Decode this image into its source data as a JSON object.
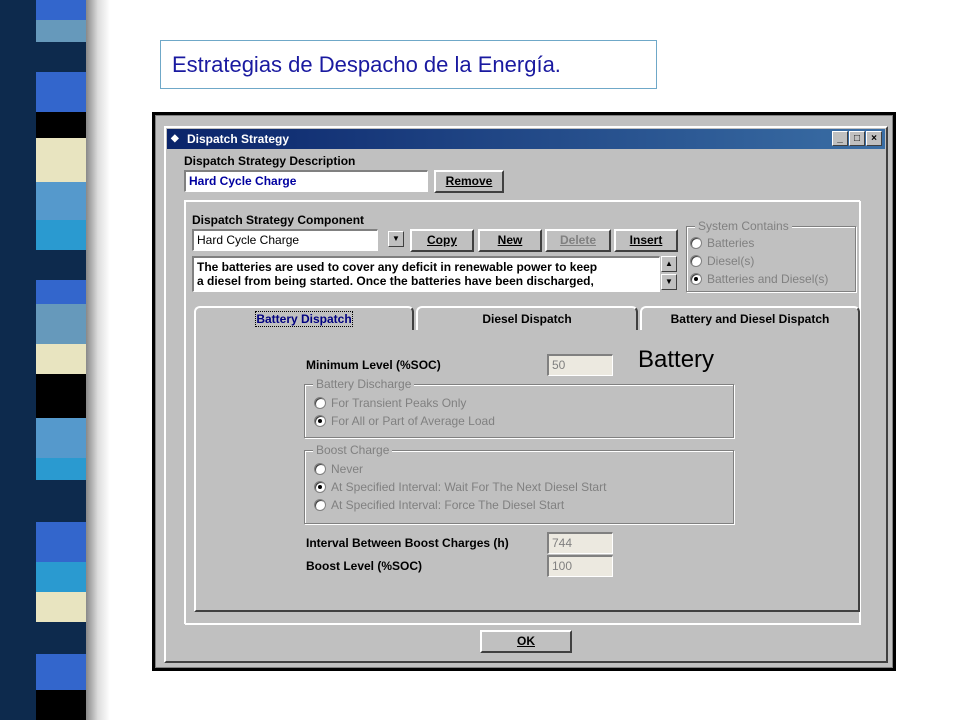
{
  "slide": {
    "title": "Estrategias de Despacho de la Energía."
  },
  "window": {
    "title": "Dispatch Strategy",
    "minimize": "_",
    "maximize": "□",
    "close": "×"
  },
  "description": {
    "label": "Dispatch Strategy Description",
    "value": "Hard Cycle Charge",
    "remove_label": "Remove"
  },
  "component": {
    "label": "Dispatch Strategy Component",
    "select_value": "Hard Cycle Charge",
    "copy_label": "Copy",
    "new_label": "New",
    "delete_label": "Delete",
    "insert_label": "Insert",
    "text_line1": "The batteries are used to cover any deficit in renewable power to keep",
    "text_line2": "a diesel from being started.  Once the batteries have been discharged,"
  },
  "system_contains": {
    "title": "System Contains",
    "options": [
      "Batteries",
      "Diesel(s)",
      "Batteries and Diesel(s)"
    ],
    "selected": 2
  },
  "tabs": [
    "Battery Dispatch",
    "Diesel Dispatch",
    "Battery and Diesel Dispatch"
  ],
  "battery": {
    "heading": "Battery",
    "min_level_label": "Minimum Level (%SOC)",
    "min_level_value": "50",
    "discharge": {
      "title": "Battery Discharge",
      "options": [
        "For Transient Peaks Only",
        "For All or Part of Average Load"
      ],
      "selected": 1
    },
    "boost": {
      "title": "Boost Charge",
      "options": [
        "Never",
        "At Specified Interval: Wait For The Next Diesel Start",
        "At Specified Interval: Force The Diesel Start"
      ],
      "selected": 1
    },
    "interval_label": "Interval Between Boost Charges (h)",
    "interval_value": "744",
    "boost_level_label": "Boost Level (%SOC)",
    "boost_level_value": "100"
  },
  "ok_label": "OK",
  "colors": {
    "title_text": "#1a1aa0",
    "titlebar": "#0a246a",
    "dialog_face": "#c0c0c0"
  }
}
